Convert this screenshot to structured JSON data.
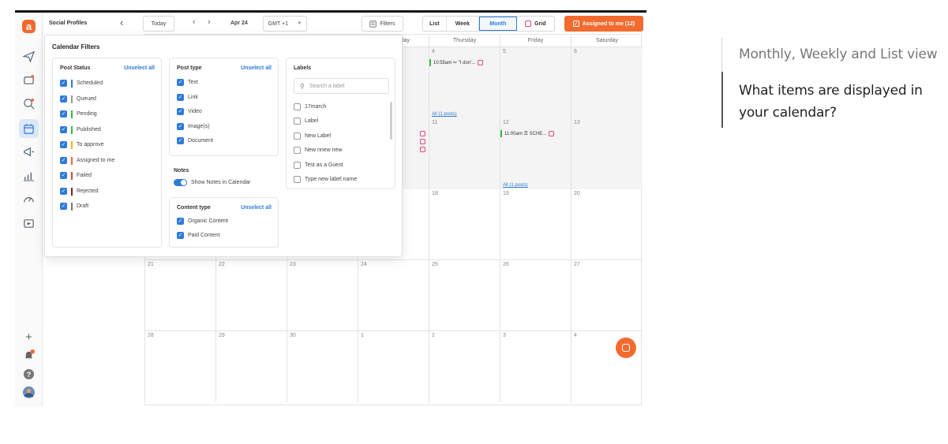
{
  "app": {
    "social_profiles_label": "Social Profiles",
    "today_button": "Today",
    "current_month": "Apr 24",
    "timezone": "GMT +1",
    "filters_button": "Filters",
    "views": [
      "List",
      "Week",
      "Month",
      "Grid"
    ],
    "selected_view": "Month",
    "assigned_button": "Assigned to me (12)",
    "accent_color": "#f26a2e",
    "primary_color": "#2f7bd8"
  },
  "calendar": {
    "weekdays": [
      "",
      "",
      "",
      "day",
      "Thursday",
      "Friday",
      "Saturday"
    ],
    "weeks": [
      [
        "",
        "",
        "",
        "",
        "4",
        "5",
        "6"
      ],
      [
        "",
        "",
        "",
        "",
        "11",
        "12",
        "13"
      ],
      [
        "",
        "",
        "",
        "",
        "18",
        "19",
        "20"
      ],
      [
        "21",
        "22",
        "23",
        "24",
        "25",
        "26",
        "27"
      ],
      [
        "28",
        "29",
        "30",
        "1",
        "2",
        "3",
        "4"
      ]
    ],
    "posts": {
      "thu_4": "10:55am  ✏ \"I don'...",
      "fri_12": "11:00am  ☰ SCHE...",
      "all_posts_thu": "All (1 posts)",
      "all_posts_fri": "All (1 posts)"
    }
  },
  "filters": {
    "title": "Calendar Filters",
    "post_status": {
      "title": "Post Status",
      "unselect": "Unselect all",
      "items": [
        {
          "label": "Scheduled",
          "color": "#2f7bd8"
        },
        {
          "label": "Queued",
          "color": "#9b9b9b"
        },
        {
          "label": "Pending",
          "color": "#3bb64a"
        },
        {
          "label": "Published",
          "color": "#3bb64a"
        },
        {
          "label": "To approve",
          "color": "#f2b21b"
        },
        {
          "label": "Assigned to me",
          "color": "#f26a2e"
        },
        {
          "label": "Failed",
          "color": "#e5443a"
        },
        {
          "label": "Rejected",
          "color": "#8c1a1a"
        },
        {
          "label": "Draft",
          "color": "#777777"
        }
      ]
    },
    "post_type": {
      "title": "Post type",
      "unselect": "Unselect all",
      "items": [
        "Text",
        "Link",
        "Video",
        "Image(s)",
        "Document"
      ]
    },
    "notes": {
      "title": "Notes",
      "toggle_label": "Show Notes in Calendar"
    },
    "content_type": {
      "title": "Content type",
      "unselect": "Unselect all",
      "items": [
        "Organic Content",
        "Paid Content"
      ]
    },
    "labels": {
      "title": "Labels",
      "search_placeholder": "Search a label",
      "items": [
        "17march",
        "Label",
        "New Label",
        "New nnew new",
        "Test as a Guest",
        "Type new label name"
      ]
    }
  },
  "sidebar_text": {
    "item1": "Monthly, Weekly and List view",
    "item2": "What items are displayed in your calendar?"
  }
}
